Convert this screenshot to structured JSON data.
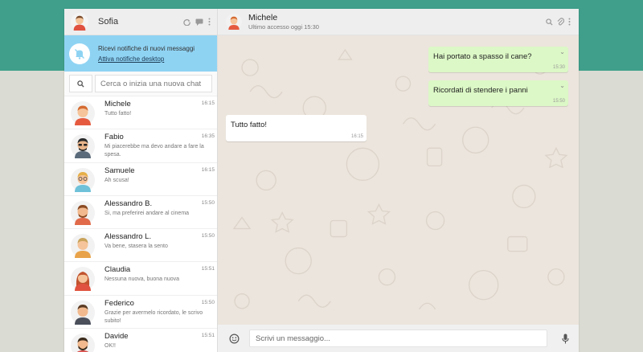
{
  "sidebar": {
    "user_name": "Sofia",
    "icons": [
      "refresh-icon",
      "chat-icon",
      "menu-icon"
    ],
    "notification": {
      "title": "Ricevi notifiche di nuovi messaggi",
      "link": "Attiva notifiche desktop"
    },
    "search": {
      "placeholder": "Cerca o inizia una nuova chat"
    },
    "contacts": [
      {
        "name": "Michele",
        "time": "16:15",
        "last_message": "Tutto fatto!"
      },
      {
        "name": "Fabio",
        "time": "16:35",
        "last_message": "Mi piacerebbe ma devo andare a fare la spesa."
      },
      {
        "name": "Samuele",
        "time": "16:15",
        "last_message": "Ah scusa!"
      },
      {
        "name": "Alessandro B.",
        "time": "15:50",
        "last_message": "Si, ma preferirei andare al cinema"
      },
      {
        "name": "Alessandro L.",
        "time": "15:50",
        "last_message": "Va bene, stasera la sento"
      },
      {
        "name": "Claudia",
        "time": "15:51",
        "last_message": "Nessuna nuova, buona nuova"
      },
      {
        "name": "Federico",
        "time": "15:50",
        "last_message": "Grazie per avermelo ricordato, le scrivo subito!"
      },
      {
        "name": "Davide",
        "time": "15:51",
        "last_message": "OK!!"
      }
    ]
  },
  "chat": {
    "contact_name": "Michele",
    "status": "Ultimo accesso oggi 15:30",
    "messages": [
      {
        "direction": "sent",
        "text": "Hai portato a spasso il cane?",
        "time": "15:30"
      },
      {
        "direction": "sent",
        "text": "Ricordati di stendere i panni",
        "time": "15:50"
      },
      {
        "direction": "received",
        "text": "Tutto fatto!",
        "time": "16:15"
      }
    ],
    "composer": {
      "placeholder": "Scrivi un messaggio..."
    }
  },
  "colors": {
    "header_band": "#3f9f8a",
    "background": "#dadbd3",
    "notification": "#8fd3f3",
    "sent_bubble": "#dcf8c6",
    "chat_wallpaper": "#ece5dd"
  }
}
